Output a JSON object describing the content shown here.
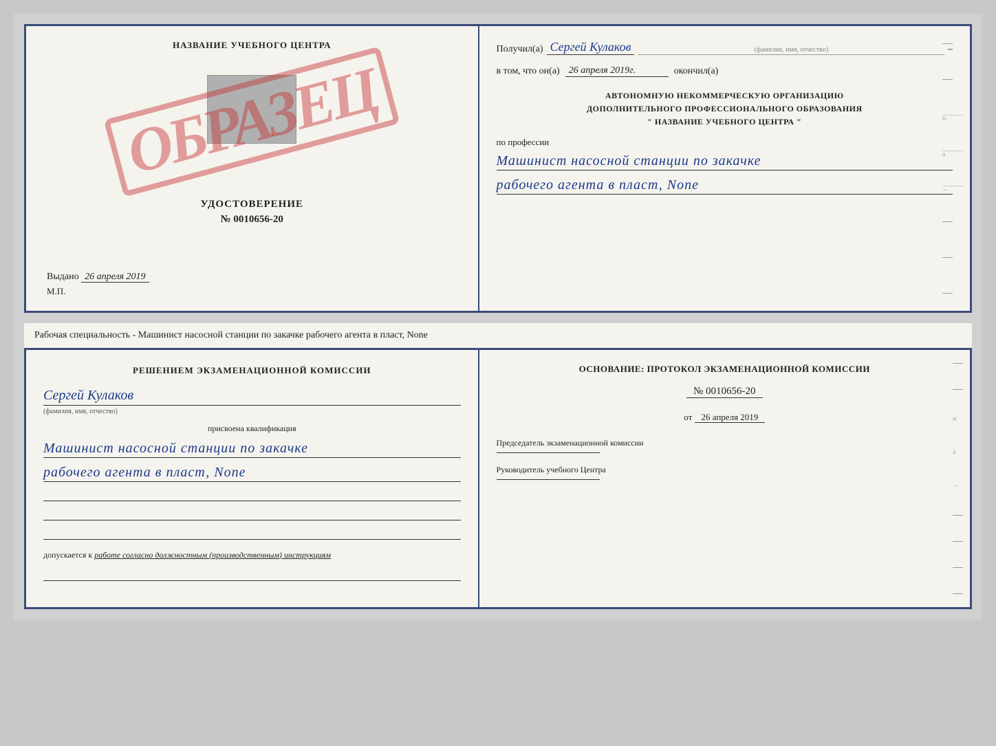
{
  "top_left": {
    "training_center": "НАЗВАНИЕ УЧЕБНОГО ЦЕНТРА",
    "stamp_text": "ОБРАЗЕЦ",
    "certificate_label": "УДОСТОВЕРЕНИЕ",
    "certificate_number": "№ 0010656-20",
    "issued_label": "Выдано",
    "issued_date": "26 апреля 2019",
    "mp_label": "М.П."
  },
  "top_right": {
    "received_label": "Получил(а)",
    "recipient_name": "Сергей Кулаков",
    "recipient_sublabel": "(фамилия, имя, отчество)",
    "date_prefix": "в том, что он(а)",
    "date_value": "26 апреля 2019г.",
    "date_suffix": "окончил(а)",
    "org_line1": "АВТОНОМНУЮ НЕКОММЕРЧЕСКУЮ ОРГАНИЗАЦИЮ",
    "org_line2": "ДОПОЛНИТЕЛЬНОГО ПРОФЕССИОНАЛЬНОГО ОБРАЗОВАНИЯ",
    "org_line3": "\" НАЗВАНИЕ УЧЕБНОГО ЦЕНТРА \"",
    "profession_label": "по профессии",
    "profession_line1": "Машинист насосной станции по закачке",
    "profession_line2": "рабочего агента в пласт, None"
  },
  "description": {
    "text": "Рабочая специальность - Машинист насосной станции по закачке рабочего агента в пласт, None"
  },
  "bottom_left": {
    "decision_title": "Решением экзаменационной комиссии",
    "person_name": "Сергей Кулаков",
    "person_sublabel": "(фамилия, имя, отчество)",
    "qualification_label": "присвоена квалификация",
    "qualification_line1": "Машинист насосной станции по закачке",
    "qualification_line2": "рабочего агента в пласт, None",
    "allowed_prefix": "допускается к",
    "allowed_text": "работе согласно должностным (производственным) инструкциям"
  },
  "bottom_right": {
    "basis_label": "Основание: протокол экзаменационной комиссии",
    "number_label": "№ 0010656-20",
    "date_prefix": "от",
    "date_value": "26 апреля 2019",
    "chairman_label": "Председатель экзаменационной комиссии",
    "head_label": "Руководитель учебного Центра"
  }
}
